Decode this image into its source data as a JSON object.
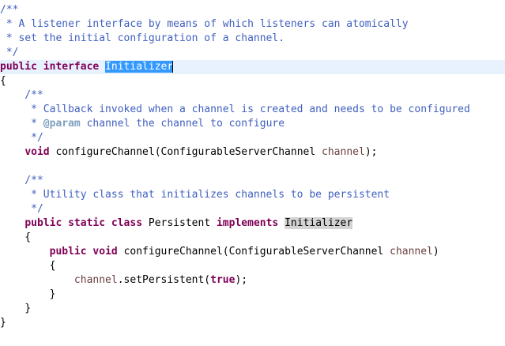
{
  "editor": {
    "lines": [
      "/**",
      " * A listener interface by means of which listeners can atomically",
      " * set the initial configuration of a channel.",
      " */",
      "public interface Initializer",
      "{",
      "    /**",
      "     * Callback invoked when a channel is created and needs to be configured",
      "     * @param channel the channel to configure",
      "     */",
      "    void configureChannel(ConfigurableServerChannel channel);",
      "",
      "    /**",
      "     * Utility class that initializes channels to be persistent",
      "     */",
      "    public static class Persistent implements Initializer",
      "    {",
      "        public void configureChannel(ConfigurableServerChannel channel)",
      "        {",
      "            channel.setPersistent(true);",
      "        }",
      "    }",
      "}"
    ],
    "tokens": {
      "kw_public": "public",
      "kw_interface": "interface",
      "kw_void": "void",
      "kw_static": "static",
      "kw_class": "class",
      "kw_implements": "implements",
      "kw_true": "true",
      "tag_param": "@param",
      "selected_word": "Initializer",
      "occurrence_word": "Initializer",
      "param_name": "channel",
      "method_name": "configureChannel",
      "param_type": "ConfigurableServerChannel",
      "class_name": "Persistent",
      "method_call": "setPersistent"
    },
    "colors": {
      "keyword": "#7f0055",
      "javadoc": "#3f5fbf",
      "javadoc_tag": "#7f9fbf",
      "variable": "#6a3e3e",
      "selection": "#3399ff",
      "occurrence": "#d4d4d4",
      "current_line": "#e8f2fe"
    }
  }
}
